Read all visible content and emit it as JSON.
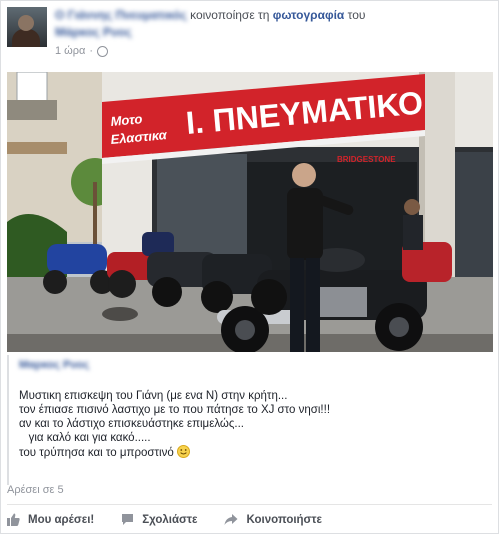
{
  "post": {
    "author_name": "Ο Γιάννης Πνευματικός",
    "action_text": "κοινοποίησε τη",
    "object_link": "φωτογραφία",
    "object_suffix": "του",
    "original_author": "Μάρκος Ρυος",
    "time": "1 ώρα",
    "privacy_icon": "globe-icon"
  },
  "photo": {
    "shop_sign_small": "Μοτο Ελαστικα",
    "shop_sign_main": "Ι. ΠΝΕΥΜΑΤΙΚΟ",
    "inner_sign": "BRIDGESTONE"
  },
  "shared": {
    "author": "Μαρκος Ρυος",
    "lines": [
      "Μυστικη επισκεψη του Γιάνη (με ενα Ν) στην κρήτη...",
      "τον έπιασε πισινό λαστιχο με το που πάτησε το XJ στο νησι!!!",
      "αν και το λάστιχο επισκευάστηκε επιμελώς...",
      "   για καλό και για κακό.....",
      "του τρύπησα και το μπροστινό "
    ],
    "emoji": "smile-emoji"
  },
  "likes_text": "Αρέσει σε 5",
  "actions": {
    "like_label": "Μου αρέσει!",
    "comment_label": "Σχολιάστε",
    "share_label": "Κοινοποιήστε"
  },
  "colors": {
    "link": "#365899",
    "sign_red": "#d2232a",
    "meta_gray": "#90949c"
  }
}
